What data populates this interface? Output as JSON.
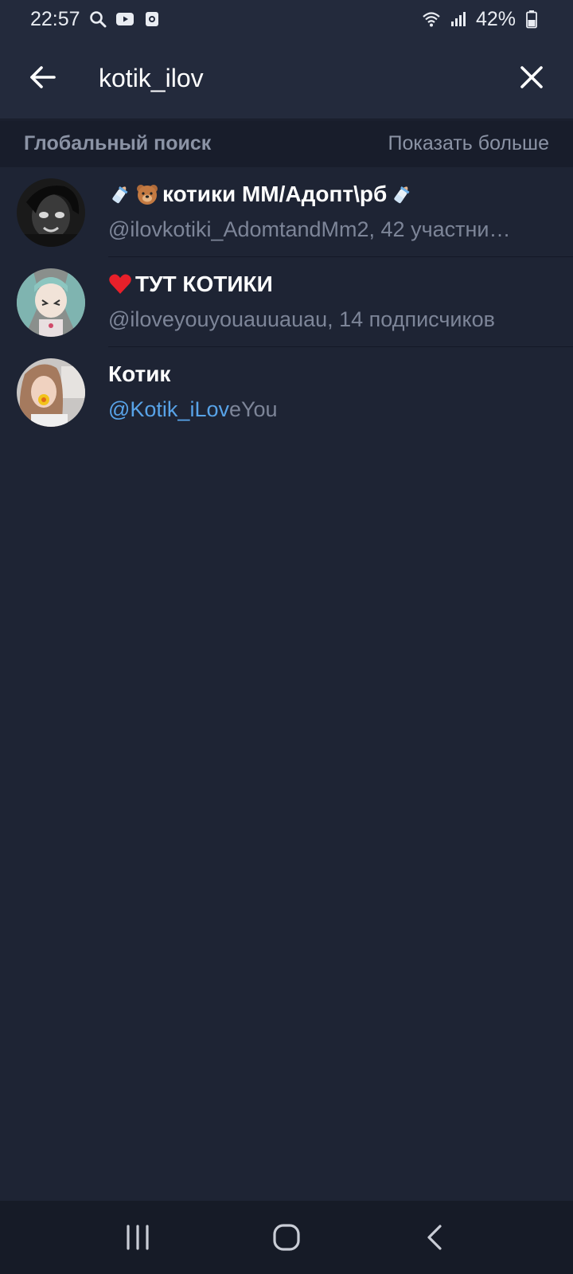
{
  "status_bar": {
    "time": "22:57",
    "battery": "42%",
    "left_icons": [
      "search-icon",
      "youtube-icon",
      "screen-record-icon"
    ],
    "right_icons": [
      "wifi-icon",
      "signal-icon",
      "battery-icon"
    ]
  },
  "header": {
    "query": "kotik_ilov",
    "back_icon": "arrow-left-icon",
    "clear_icon": "close-icon"
  },
  "section": {
    "title": "Глобальный поиск",
    "more_label": "Показать больше"
  },
  "results": [
    {
      "title": "котики ММ/Адопт\\рб",
      "title_emoji_prefix": [
        "baby-bottle",
        "bear"
      ],
      "title_emoji_suffix": [
        "baby-bottle"
      ],
      "subtitle": "@ilovkotiki_AdomtandMm2, 42 участни…"
    },
    {
      "title": "ТУТ КОТИКИ",
      "title_emoji_prefix": [
        "red-heart"
      ],
      "subtitle": "@iloveyouyouauuauau, 14 подписчиков"
    },
    {
      "title": "Котик",
      "subtitle_match": "@Kotik_iLov",
      "subtitle_rest": "eYou"
    }
  ],
  "navbar": {
    "icons": [
      "recent-apps-icon",
      "home-icon",
      "back-icon"
    ]
  },
  "colors": {
    "background": "#1e2434",
    "header": "#232a3c",
    "section_header": "#181d2b",
    "accent": "#58a3e8",
    "muted_text": "#7d8598"
  }
}
